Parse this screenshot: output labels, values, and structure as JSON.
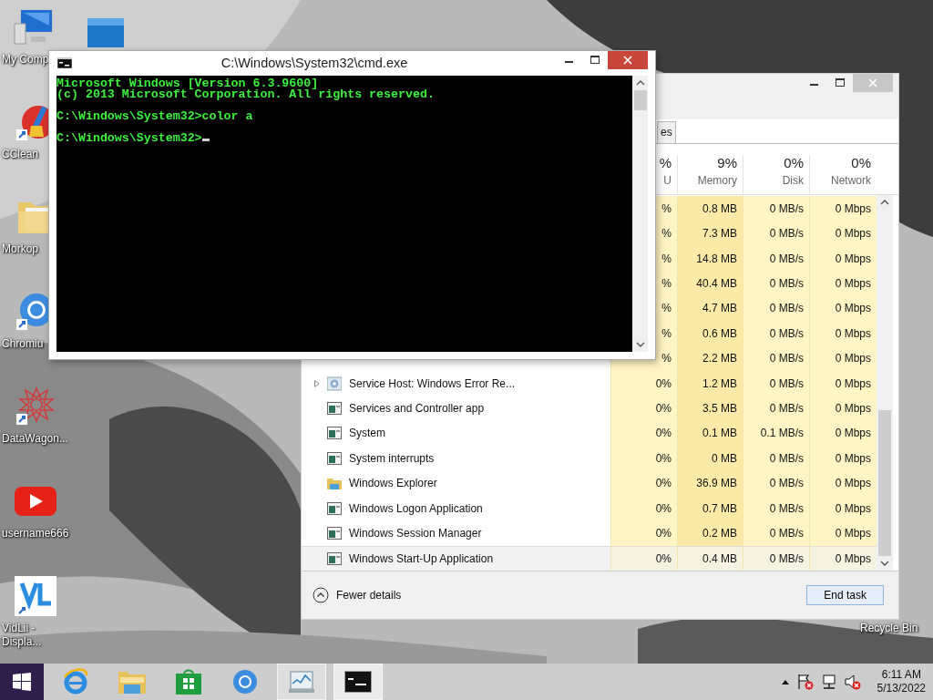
{
  "desktop_columns": [
    [
      {
        "kind": "computer",
        "label": "My Comp"
      },
      {
        "kind": "cleaner",
        "label": "CClean"
      },
      {
        "kind": "folder",
        "label": "Morkop"
      },
      {
        "kind": "chromium",
        "label": "Chromiu"
      },
      {
        "kind": "star",
        "label": "DataWagon..."
      },
      {
        "kind": "video",
        "label": "username666"
      },
      {
        "kind": "vidlii",
        "label": "VidLii - Displa..."
      }
    ],
    [
      {
        "kind": "tile"
      }
    ]
  ],
  "recycle_bin": {
    "label": "Recycle Bin"
  },
  "task_manager": {
    "tabs": [
      {
        "label": "es",
        "selected": false
      }
    ],
    "columns": [
      {
        "percent": "%",
        "label": "U"
      },
      {
        "percent": "9%",
        "label": "Memory"
      },
      {
        "percent": "0%",
        "label": "Disk"
      },
      {
        "percent": "0%",
        "label": "Network"
      }
    ],
    "rows": [
      {
        "cpu": "%",
        "memory": "0.8 MB",
        "disk": "0 MB/s",
        "network": "0 Mbps",
        "selected": false
      },
      {
        "cpu": "%",
        "memory": "7.3 MB",
        "disk": "0 MB/s",
        "network": "0 Mbps",
        "selected": false
      },
      {
        "cpu": "%",
        "memory": "14.8 MB",
        "disk": "0 MB/s",
        "network": "0 Mbps",
        "selected": false
      },
      {
        "cpu": "%",
        "memory": "40.4 MB",
        "disk": "0 MB/s",
        "network": "0 Mbps",
        "selected": false
      },
      {
        "cpu": "%",
        "memory": "4.7 MB",
        "disk": "0 MB/s",
        "network": "0 Mbps",
        "selected": false
      },
      {
        "cpu": "%",
        "memory": "0.6 MB",
        "disk": "0 MB/s",
        "network": "0 Mbps",
        "selected": false
      },
      {
        "cpu": "%",
        "memory": "2.2 MB",
        "disk": "0 MB/s",
        "network": "0 Mbps",
        "selected": false
      },
      {
        "name": "Service Host: Windows Error Re...",
        "kind": "gear",
        "cpu": "0%",
        "memory": "1.2 MB",
        "disk": "0 MB/s",
        "network": "0 Mbps",
        "expandable": true,
        "selected": false
      },
      {
        "name": "Services and Controller app",
        "kind": "app",
        "cpu": "0%",
        "memory": "3.5 MB",
        "disk": "0 MB/s",
        "network": "0 Mbps",
        "expandable": false,
        "selected": false
      },
      {
        "name": "System",
        "kind": "app",
        "cpu": "0%",
        "memory": "0.1 MB",
        "disk": "0.1 MB/s",
        "network": "0 Mbps",
        "expandable": false,
        "selected": false
      },
      {
        "name": "System interrupts",
        "kind": "app",
        "cpu": "0%",
        "memory": "0 MB",
        "disk": "0 MB/s",
        "network": "0 Mbps",
        "expandable": false,
        "selected": false
      },
      {
        "name": "Windows Explorer",
        "kind": "folder",
        "cpu": "0%",
        "memory": "36.9 MB",
        "disk": "0 MB/s",
        "network": "0 Mbps",
        "expandable": false,
        "selected": false
      },
      {
        "name": "Windows Logon Application",
        "kind": "app",
        "cpu": "0%",
        "memory": "0.7 MB",
        "disk": "0 MB/s",
        "network": "0 Mbps",
        "expandable": false,
        "selected": false
      },
      {
        "name": "Windows Session Manager",
        "kind": "app",
        "cpu": "0%",
        "memory": "0.2 MB",
        "disk": "0 MB/s",
        "network": "0 Mbps",
        "expandable": false,
        "selected": false
      },
      {
        "name": "Windows Start-Up Application",
        "kind": "app",
        "cpu": "0%",
        "memory": "0.4 MB",
        "disk": "0 MB/s",
        "network": "0 Mbps",
        "expandable": false,
        "selected": true
      }
    ],
    "fewer_details": "Fewer details",
    "end_task": "End task"
  },
  "cmd": {
    "title": "C:\\Windows\\System32\\cmd.exe",
    "paragraphs": [
      [
        "Microsoft Windows [Version 6.3.9600]",
        "(c) 2013 Microsoft Corporation. All rights reserved."
      ],
      [
        "C:\\Windows\\System32>color a"
      ],
      [
        "C:\\Windows\\System32>"
      ]
    ],
    "cursor": true
  },
  "taskbar": {
    "items": [
      {
        "kind": "ie",
        "running": false
      },
      {
        "kind": "explorer",
        "running": false
      },
      {
        "kind": "store",
        "running": false
      },
      {
        "kind": "chromium",
        "running": false
      },
      {
        "kind": "taskmgr",
        "running": true
      },
      {
        "kind": "cmd",
        "running": true
      }
    ],
    "time": "6:11 AM",
    "date": "5/13/2022"
  }
}
